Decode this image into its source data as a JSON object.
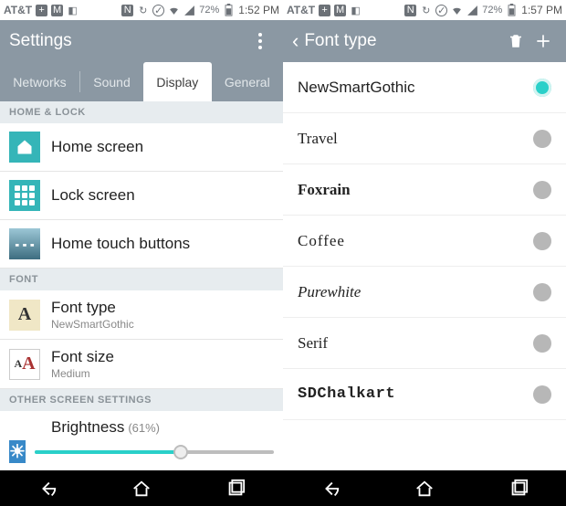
{
  "left": {
    "statusbar": {
      "carrier": "AT&T",
      "battery_pct": "72%",
      "time": "1:52 PM"
    },
    "appbar": {
      "title": "Settings"
    },
    "tabs": [
      "Networks",
      "Sound",
      "Display",
      "General"
    ],
    "active_tab": "Display",
    "sections": {
      "home_lock": {
        "header": "HOME & LOCK",
        "items": [
          {
            "title": "Home screen"
          },
          {
            "title": "Lock screen"
          },
          {
            "title": "Home touch buttons"
          }
        ]
      },
      "font": {
        "header": "FONT",
        "items": [
          {
            "title": "Font type",
            "sub": "NewSmartGothic"
          },
          {
            "title": "Font size",
            "sub": "Medium"
          }
        ]
      },
      "other": {
        "header": "OTHER SCREEN SETTINGS",
        "brightness": {
          "label": "Brightness",
          "pct_text": "(61%)",
          "pct_value": 61
        }
      }
    }
  },
  "right": {
    "statusbar": {
      "carrier": "AT&T",
      "battery_pct": "72%",
      "time": "1:57 PM"
    },
    "appbar": {
      "title": "Font type"
    },
    "fonts": [
      {
        "name": "NewSmartGothic",
        "style": "",
        "selected": true
      },
      {
        "name": "Travel",
        "style": "ff-travel",
        "selected": false
      },
      {
        "name": "Foxrain",
        "style": "ff-foxrain",
        "selected": false
      },
      {
        "name": "Coffee",
        "style": "ff-coffee",
        "selected": false
      },
      {
        "name": "Purewhite",
        "style": "ff-purewhite",
        "selected": false
      },
      {
        "name": "Serif",
        "style": "ff-serif",
        "selected": false
      },
      {
        "name": "SDChalkart",
        "style": "ff-chalk",
        "selected": false
      }
    ]
  }
}
